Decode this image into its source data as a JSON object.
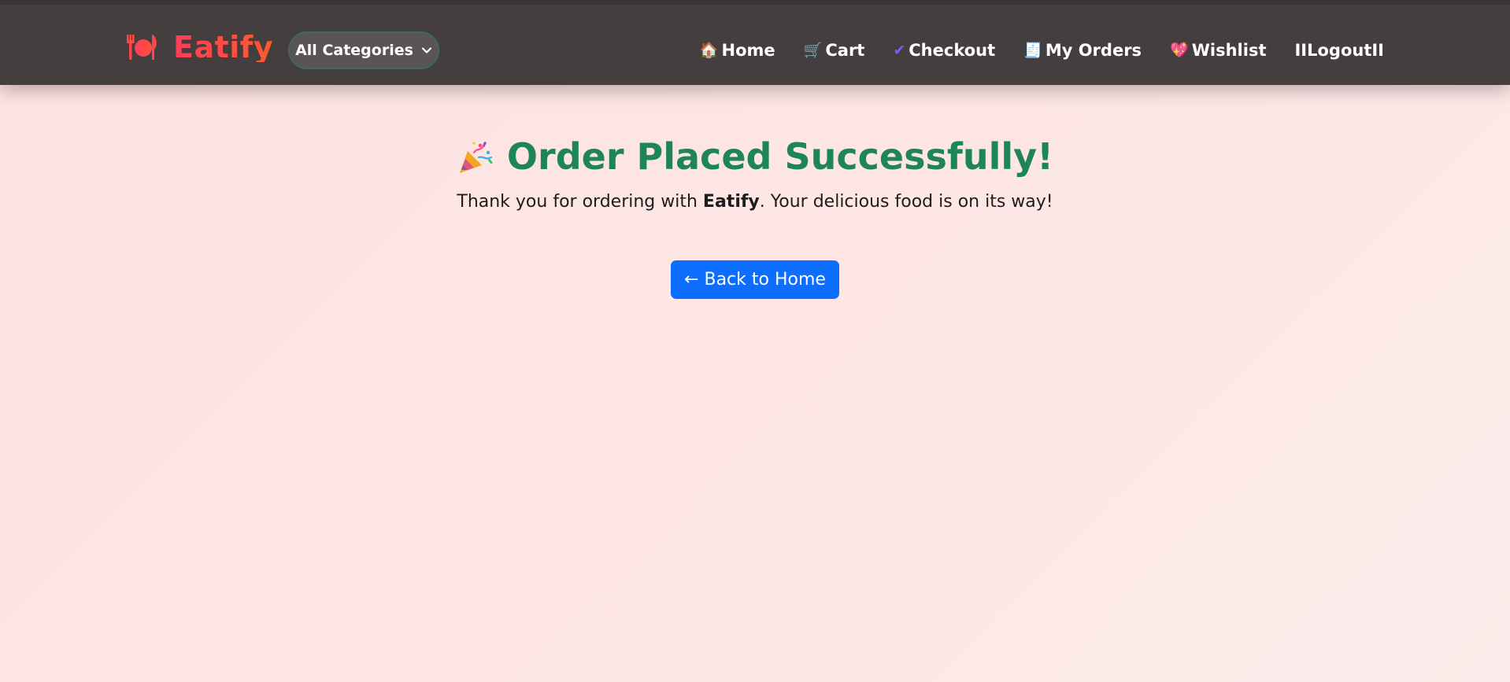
{
  "brand": {
    "name": "Eatify",
    "icon": "plate-cutlery-icon",
    "colors": [
      "#ff3d5a",
      "#ff5a2c"
    ]
  },
  "categories": {
    "selected": "All Categories"
  },
  "nav": {
    "items": [
      {
        "emoji": "🏠",
        "label": "Home",
        "icon": "house-icon"
      },
      {
        "emoji": "🛒",
        "label": "Cart",
        "icon": "cart-icon"
      },
      {
        "emoji": "✔",
        "label": "Checkout",
        "icon": "checkmark-icon"
      },
      {
        "emoji": "🧾",
        "label": "My Orders",
        "icon": "receipt-icon"
      },
      {
        "emoji": "💖",
        "label": "Wishlist",
        "icon": "heart-icon"
      },
      {
        "emoji": "",
        "label": "IILogoutII",
        "icon": ""
      }
    ]
  },
  "main": {
    "title": "Order Placed Successfully!",
    "title_icon": "party-popper-icon",
    "subtitle_pre": "Thank you for ordering with ",
    "subtitle_brand": "Eatify",
    "subtitle_post": ". Your delicious food is on its way!",
    "back_button": "← Back to Home"
  },
  "colors": {
    "navbar_bg": "#443e3e",
    "title_green": "#1e8654",
    "button_blue": "#0d6efd"
  }
}
